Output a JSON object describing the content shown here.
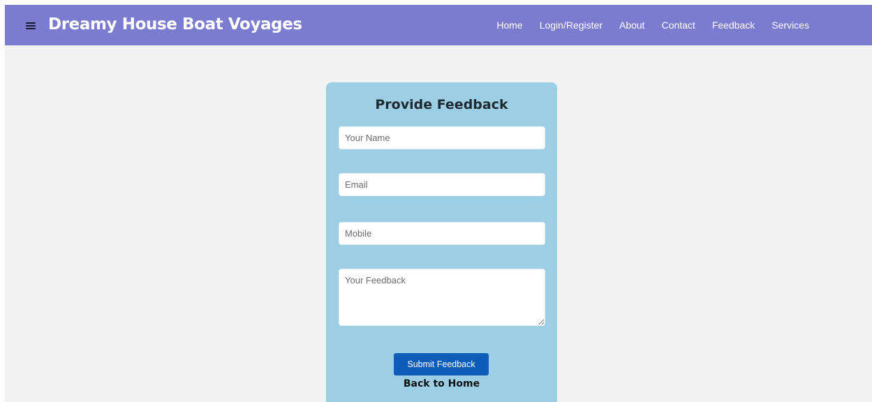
{
  "navbar": {
    "brand": "Dreamy House Boat Voyages",
    "menu_icon": "hamburger-menu-icon",
    "background_color": "#7b7bd0",
    "links": [
      {
        "label": "Home"
      },
      {
        "label": "Login/Register"
      },
      {
        "label": "About"
      },
      {
        "label": "Contact"
      },
      {
        "label": "Feedback"
      },
      {
        "label": "Services"
      }
    ]
  },
  "form": {
    "title": "Provide Feedback",
    "card_color": "#9ccfe6",
    "fields": {
      "name": {
        "placeholder": "Your Name",
        "value": ""
      },
      "email": {
        "placeholder": "Email",
        "value": ""
      },
      "mobile": {
        "placeholder": "Mobile",
        "value": ""
      },
      "feedback": {
        "placeholder": "Your Feedback",
        "value": ""
      }
    },
    "submit_label": "Submit Feedback",
    "submit_color": "#0d5db8",
    "back_label": "Back to Home"
  }
}
